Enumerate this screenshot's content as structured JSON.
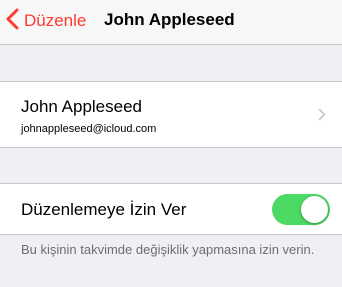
{
  "navbar": {
    "back_label": "Düzenle",
    "back_icon": "chevron-left-icon",
    "title": "John Appleseed"
  },
  "contact": {
    "name": "John Appleseed",
    "email": "johnappleseed@icloud.com",
    "disclosure_icon": "chevron-right-icon"
  },
  "permission": {
    "label": "Düzenlemeye İzin Ver",
    "enabled": true
  },
  "footer": {
    "text": "Bu kişinin takvimde değişiklik yapmasına izin verin."
  },
  "colors": {
    "accent": "#ff3b30",
    "switch_on": "#4cd964",
    "background": "#efeff4"
  }
}
